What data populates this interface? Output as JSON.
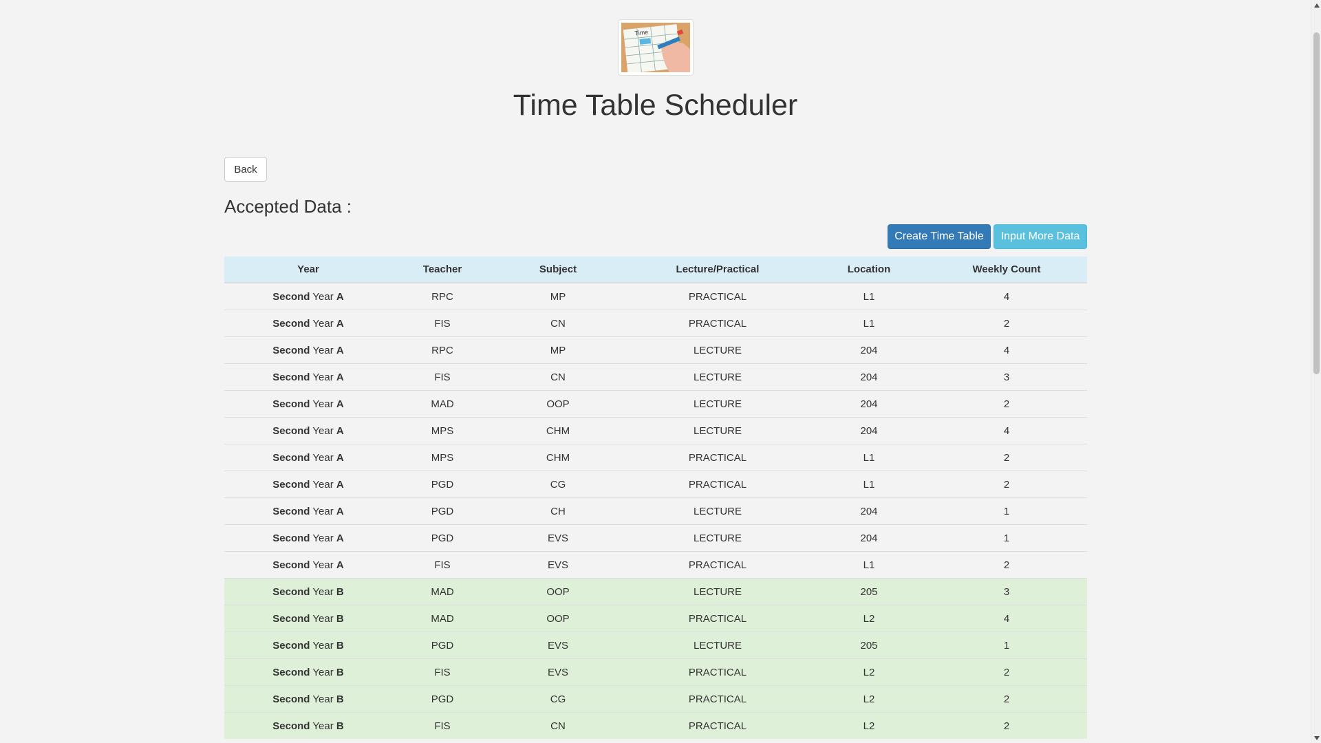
{
  "header": {
    "title": "Time Table Scheduler",
    "logo_icon": "timetable-illustration-icon"
  },
  "nav": {
    "back_label": "Back"
  },
  "section": {
    "title": "Accepted Data :"
  },
  "actions": {
    "create_label": "Create Time Table",
    "input_more_label": "Input More Data",
    "primary_color": "#337ab7",
    "info_color": "#5bc0de"
  },
  "table": {
    "headers": [
      "Year",
      "Teacher",
      "Subject",
      "Lecture/Practical",
      "Location",
      "Weekly Count"
    ],
    "header_bg": "#d9edf7",
    "group_b_bg": "#dff0d8",
    "rows": [
      {
        "year_prefix": "Second",
        "year_word": "Year",
        "division": "A",
        "teacher": "RPC",
        "subject": "MP",
        "type": "PRACTICAL",
        "location": "L1",
        "count": "4"
      },
      {
        "year_prefix": "Second",
        "year_word": "Year",
        "division": "A",
        "teacher": "FIS",
        "subject": "CN",
        "type": "PRACTICAL",
        "location": "L1",
        "count": "2"
      },
      {
        "year_prefix": "Second",
        "year_word": "Year",
        "division": "A",
        "teacher": "RPC",
        "subject": "MP",
        "type": "LECTURE",
        "location": "204",
        "count": "4"
      },
      {
        "year_prefix": "Second",
        "year_word": "Year",
        "division": "A",
        "teacher": "FIS",
        "subject": "CN",
        "type": "LECTURE",
        "location": "204",
        "count": "3"
      },
      {
        "year_prefix": "Second",
        "year_word": "Year",
        "division": "A",
        "teacher": "MAD",
        "subject": "OOP",
        "type": "LECTURE",
        "location": "204",
        "count": "2"
      },
      {
        "year_prefix": "Second",
        "year_word": "Year",
        "division": "A",
        "teacher": "MPS",
        "subject": "CHM",
        "type": "LECTURE",
        "location": "204",
        "count": "4"
      },
      {
        "year_prefix": "Second",
        "year_word": "Year",
        "division": "A",
        "teacher": "MPS",
        "subject": "CHM",
        "type": "PRACTICAL",
        "location": "L1",
        "count": "2"
      },
      {
        "year_prefix": "Second",
        "year_word": "Year",
        "division": "A",
        "teacher": "PGD",
        "subject": "CG",
        "type": "PRACTICAL",
        "location": "L1",
        "count": "2"
      },
      {
        "year_prefix": "Second",
        "year_word": "Year",
        "division": "A",
        "teacher": "PGD",
        "subject": "CH",
        "type": "LECTURE",
        "location": "204",
        "count": "1"
      },
      {
        "year_prefix": "Second",
        "year_word": "Year",
        "division": "A",
        "teacher": "PGD",
        "subject": "EVS",
        "type": "LECTURE",
        "location": "204",
        "count": "1"
      },
      {
        "year_prefix": "Second",
        "year_word": "Year",
        "division": "A",
        "teacher": "FIS",
        "subject": "EVS",
        "type": "PRACTICAL",
        "location": "L1",
        "count": "2"
      },
      {
        "year_prefix": "Second",
        "year_word": "Year",
        "division": "B",
        "teacher": "MAD",
        "subject": "OOP",
        "type": "LECTURE",
        "location": "205",
        "count": "3"
      },
      {
        "year_prefix": "Second",
        "year_word": "Year",
        "division": "B",
        "teacher": "MAD",
        "subject": "OOP",
        "type": "PRACTICAL",
        "location": "L2",
        "count": "4"
      },
      {
        "year_prefix": "Second",
        "year_word": "Year",
        "division": "B",
        "teacher": "PGD",
        "subject": "EVS",
        "type": "LECTURE",
        "location": "205",
        "count": "1"
      },
      {
        "year_prefix": "Second",
        "year_word": "Year",
        "division": "B",
        "teacher": "FIS",
        "subject": "EVS",
        "type": "PRACTICAL",
        "location": "L2",
        "count": "2"
      },
      {
        "year_prefix": "Second",
        "year_word": "Year",
        "division": "B",
        "teacher": "PGD",
        "subject": "CG",
        "type": "PRACTICAL",
        "location": "L2",
        "count": "2"
      },
      {
        "year_prefix": "Second",
        "year_word": "Year",
        "division": "B",
        "teacher": "FIS",
        "subject": "CN",
        "type": "PRACTICAL",
        "location": "L2",
        "count": "2"
      }
    ]
  }
}
